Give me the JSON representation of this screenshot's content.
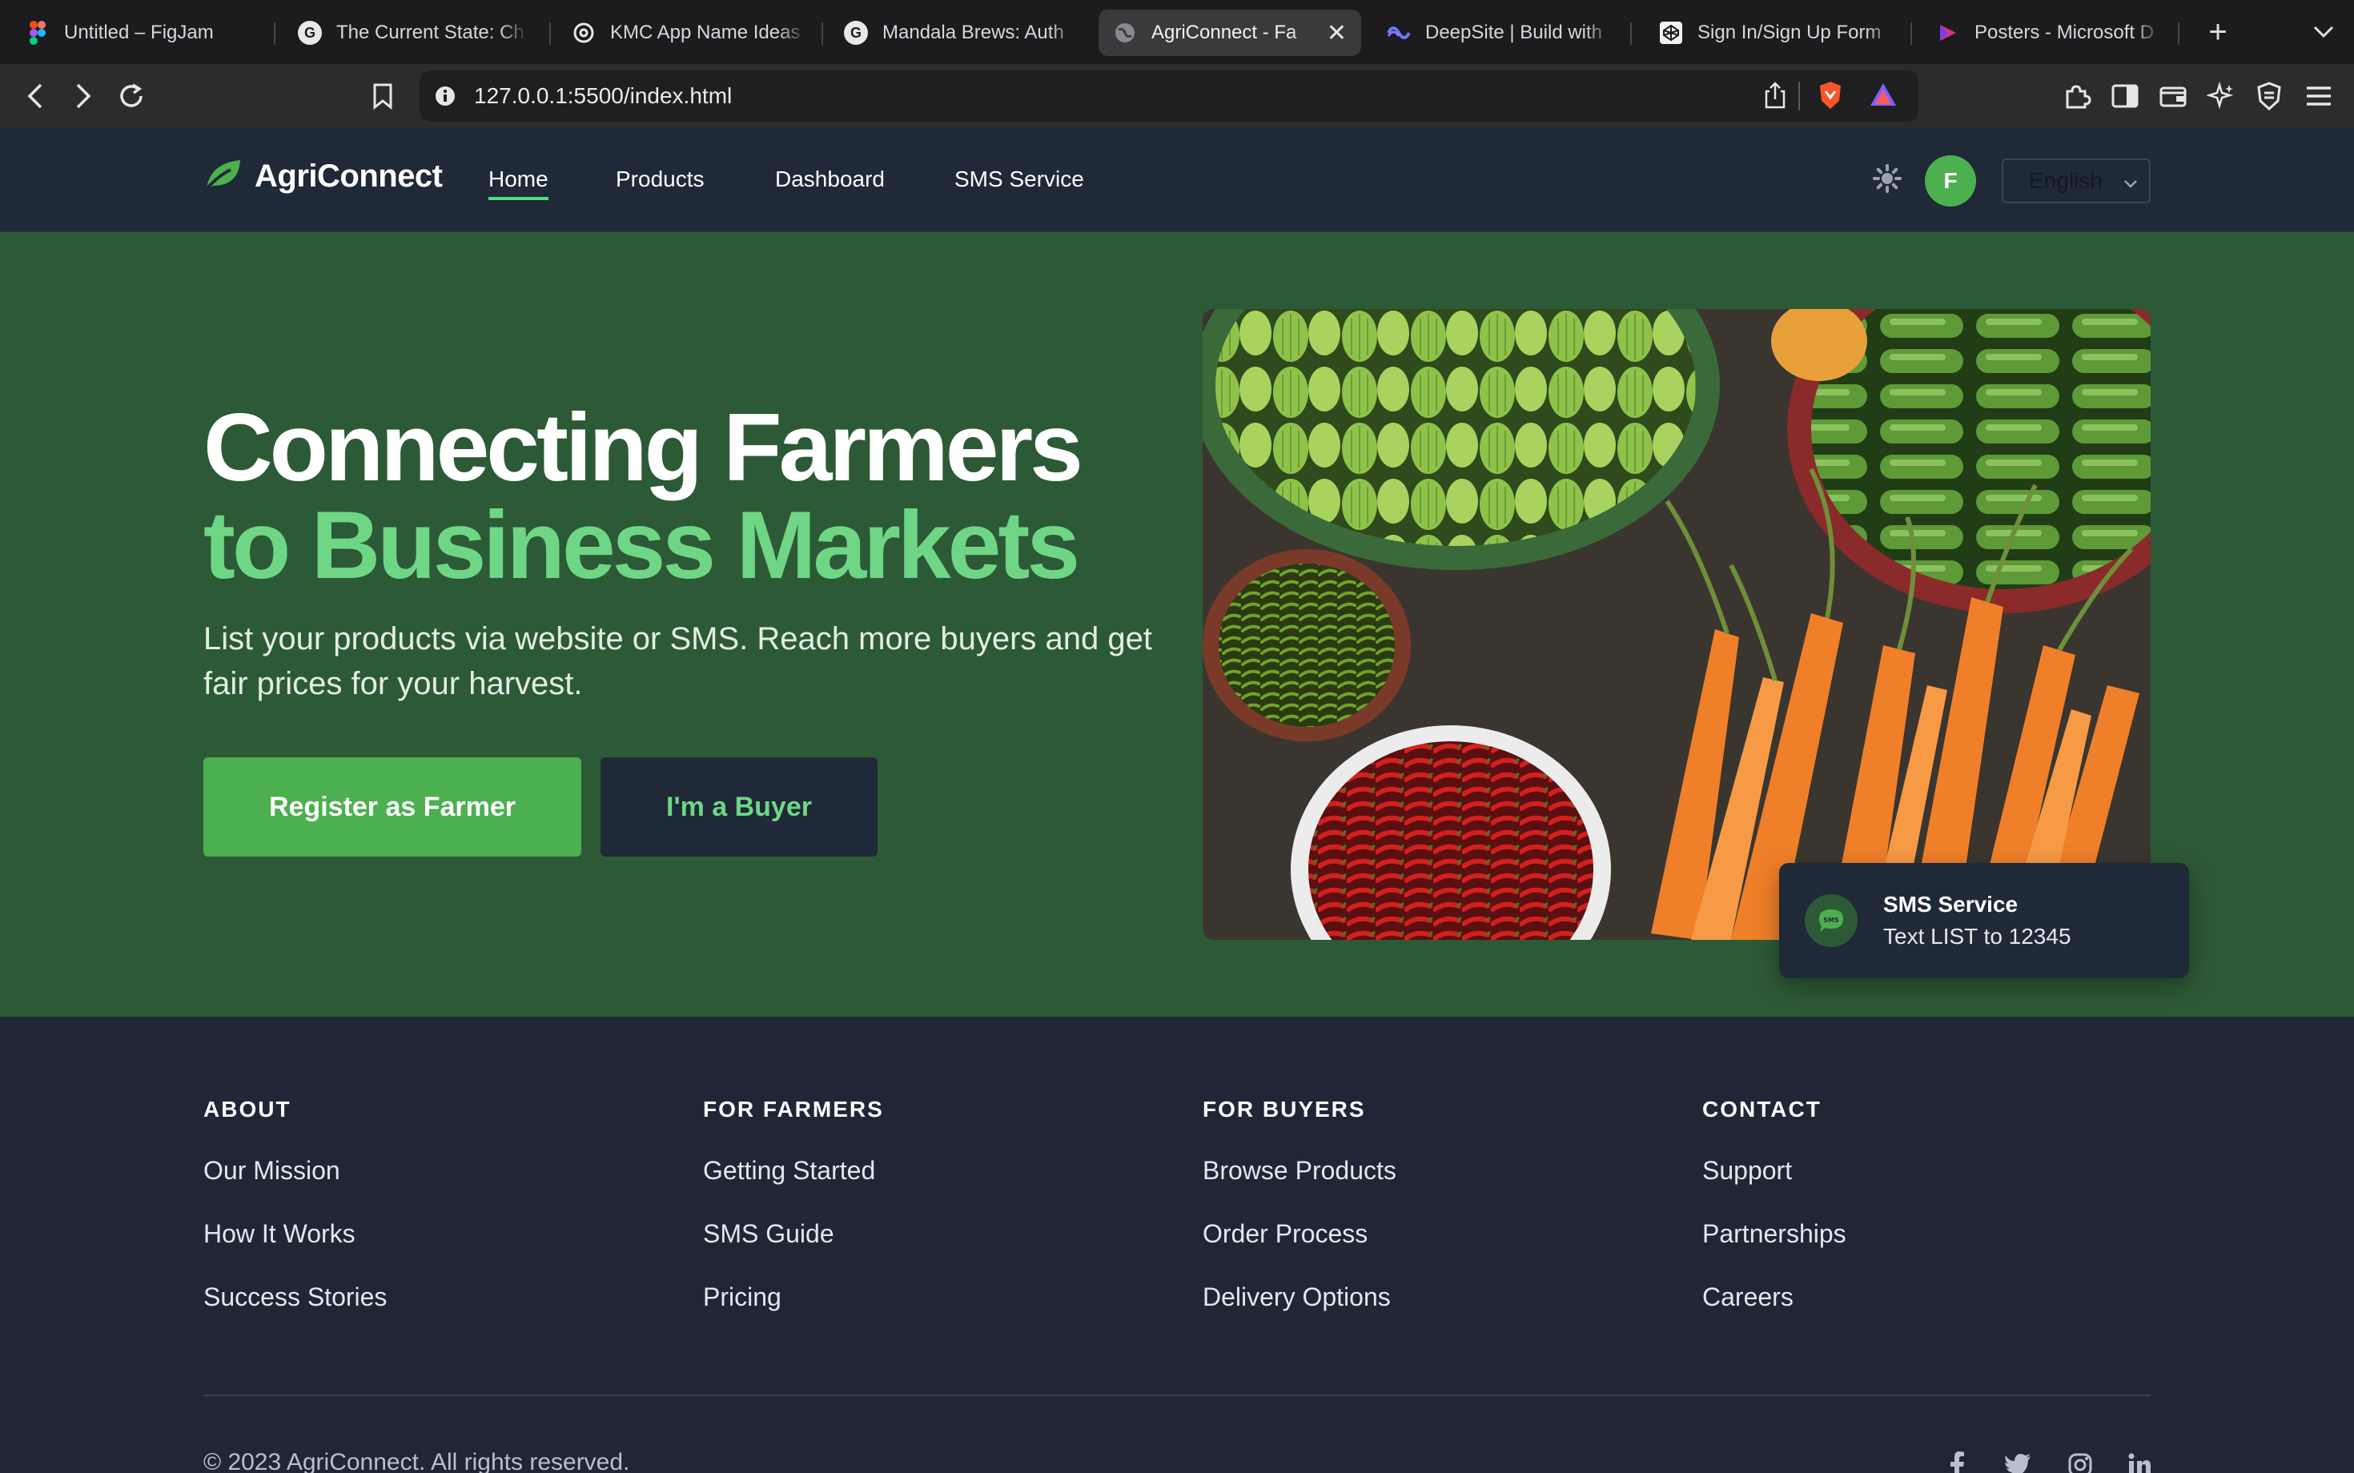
{
  "browser": {
    "tabs": [
      {
        "title": "Untitled – FigJam",
        "icon": "figma-icon"
      },
      {
        "title": "The Current State: Ch",
        "icon": "google-g-icon"
      },
      {
        "title": "KMC App Name Ideas",
        "icon": "openai-icon"
      },
      {
        "title": "Mandala Brews: Auth",
        "icon": "google-g-icon"
      },
      {
        "title": "AgriConnect - Fa",
        "icon": "globe-icon",
        "active": true
      },
      {
        "title": "DeepSite | Build with",
        "icon": "deepsite-icon"
      },
      {
        "title": "Sign In/Sign Up Form",
        "icon": "codepen-icon"
      },
      {
        "title": "Posters - Microsoft D",
        "icon": "microsoft-designer-icon"
      }
    ],
    "url": "127.0.0.1:5500/index.html"
  },
  "navbar": {
    "brand": "AgriConnect",
    "links": [
      "Home",
      "Products",
      "Dashboard",
      "SMS Service"
    ],
    "avatar_initial": "F",
    "language": "English"
  },
  "hero": {
    "title_line1": "Connecting Farmers",
    "title_line2": "to Business Markets",
    "subtitle": "List your products via website or SMS. Reach more buyers and get fair prices for your harvest.",
    "btn_farmer": "Register as Farmer",
    "btn_buyer": "I'm a Buyer",
    "sms_card": {
      "title": "SMS Service",
      "text": "Text LIST to 12345"
    }
  },
  "footer": {
    "columns": [
      {
        "heading": "ABOUT",
        "links": [
          "Our Mission",
          "How It Works",
          "Success Stories"
        ]
      },
      {
        "heading": "FOR FARMERS",
        "links": [
          "Getting Started",
          "SMS Guide",
          "Pricing"
        ]
      },
      {
        "heading": "FOR BUYERS",
        "links": [
          "Browse Products",
          "Order Process",
          "Delivery Options"
        ]
      },
      {
        "heading": "CONTACT",
        "links": [
          "Support",
          "Partnerships",
          "Careers"
        ]
      }
    ],
    "copyright": "© 2023 AgriConnect. All rights reserved.",
    "social": [
      "facebook-icon",
      "twitter-icon",
      "instagram-icon",
      "linkedin-icon"
    ]
  },
  "colors": {
    "accent": "#4caf50",
    "accent_light": "#6fd686",
    "hero_bg": "#2d5a36",
    "nav_bg": "#1f2937",
    "footer_bg": "#1f2636"
  }
}
